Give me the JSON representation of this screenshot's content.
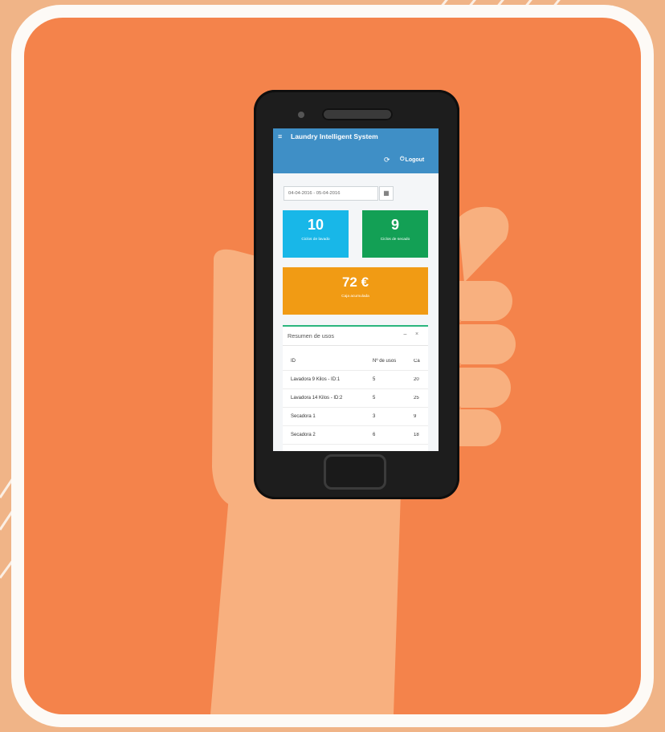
{
  "app": {
    "title": "Laundry Intelligent System",
    "logout_label": "Logout",
    "colors": {
      "appbar": "#3f8fc6",
      "tile_wash": "#18b7e8",
      "tile_dry": "#13a055",
      "tile_cash": "#f19b14",
      "background": "#f4834b"
    }
  },
  "filters": {
    "date_range": "04-04-2016 - 05-04-2016"
  },
  "stats": {
    "wash_cycles": {
      "value": "10",
      "label": "Ciclos de lavado"
    },
    "dry_cycles": {
      "value": "9",
      "label": "Ciclos de secado"
    },
    "cash": {
      "value": "72 €",
      "label": "Caja acumulada"
    }
  },
  "summary": {
    "title": "Resumen de usos",
    "columns": [
      "ID",
      "Nº de usos",
      "Ca"
    ],
    "rows": [
      [
        "Lavadora 9 Kilos - ID:1",
        "5",
        "20"
      ],
      [
        "Lavadora 14 Kilos - ID:2",
        "5",
        "25"
      ],
      [
        "Secadora 1",
        "3",
        "9"
      ],
      [
        "Secadora 2",
        "6",
        "18"
      ]
    ]
  }
}
